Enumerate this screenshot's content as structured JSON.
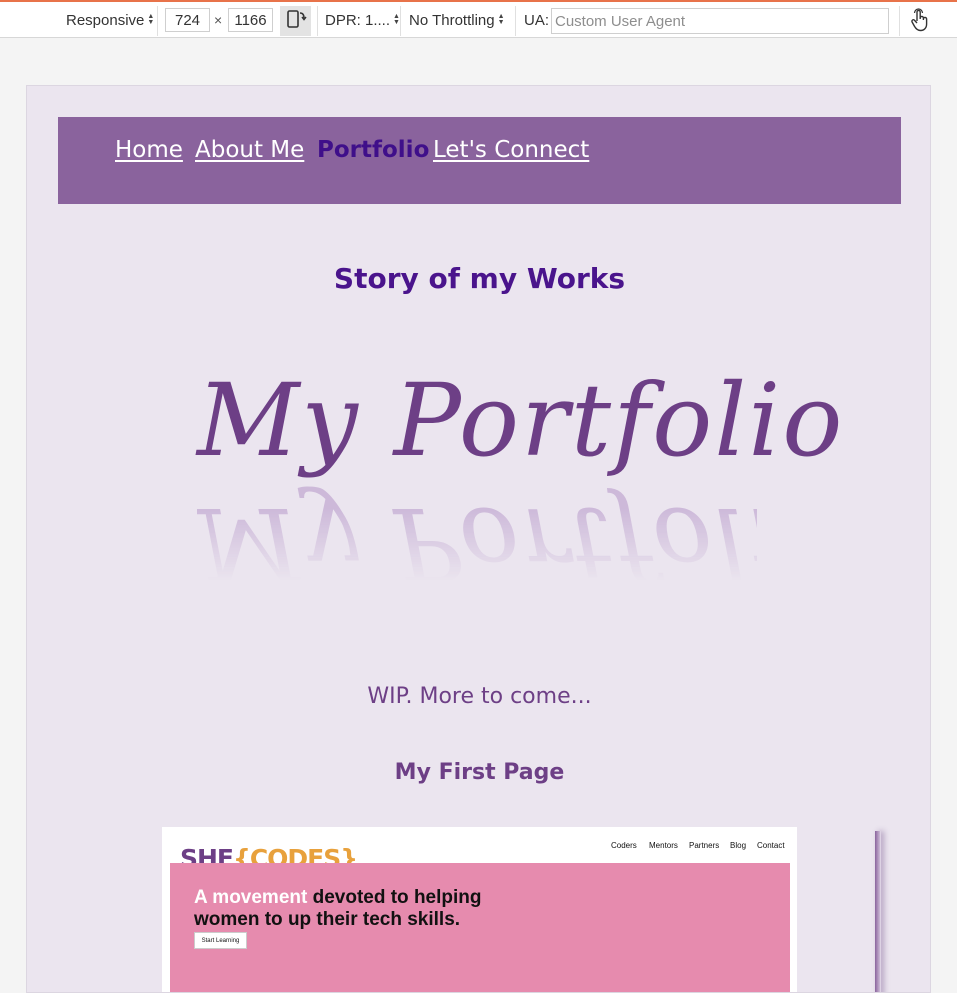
{
  "devtools": {
    "device_mode": "Responsive",
    "width": "724",
    "times": "×",
    "height": "1166",
    "dpr": "DPR: 1....",
    "throttling": "No Throttling",
    "ua_label": "UA:",
    "ua_placeholder": "Custom User Agent"
  },
  "page": {
    "nav": {
      "items": [
        {
          "label": "Home",
          "active": false
        },
        {
          "label": "About Me",
          "active": false
        },
        {
          "label": "Portfolio",
          "active": true
        },
        {
          "label": "Let's Connect",
          "active": false
        }
      ]
    },
    "story_title": "Story of my Works",
    "portfolio_script": "My Portfolio",
    "wip_text": "WIP. More to come...",
    "first_page_title": "My First Page",
    "screenshot": {
      "logo_she": "SHE",
      "logo_codes": "{CODES}",
      "menu": [
        "Coders",
        "Mentors",
        "Partners",
        "Blog",
        "Contact"
      ],
      "hero_highlight": "A movement",
      "hero_rest": " devoted to helping women to up their tech skills.",
      "button": "Start Learning"
    }
  },
  "colors": {
    "nav_bg": "#8a639d",
    "nav_link": "#ffffff",
    "nav_active": "#3f0f8a",
    "page_bg": "#ebe5ef",
    "title": "#4a148c",
    "accent_purple": "#6d3f86",
    "hero_pink": "#e68bae",
    "logo_orange": "#e8a13c"
  },
  "icons": {
    "rotate": "device-rotate-icon",
    "touch": "touch-hand-icon"
  }
}
